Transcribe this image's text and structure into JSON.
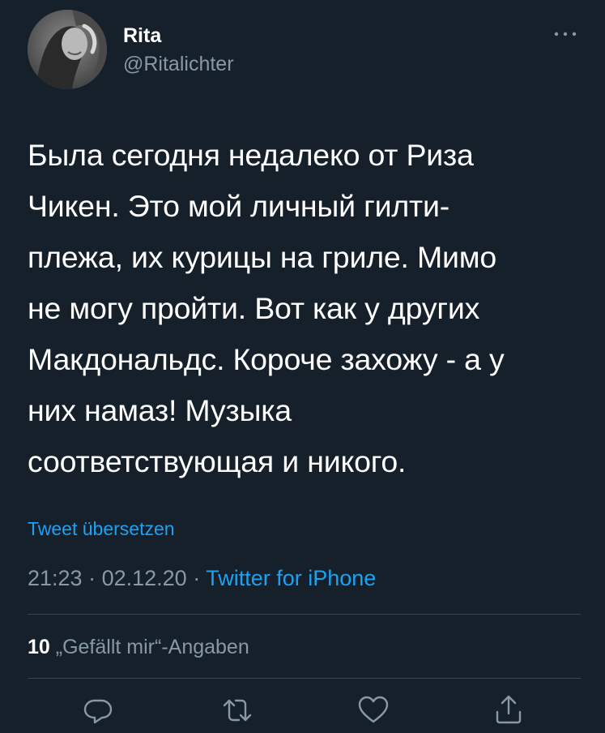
{
  "user": {
    "display_name": "Rita",
    "handle": "@Ritalichter",
    "avatar_icon": "avatar-photo"
  },
  "tweet": {
    "lines": [
      "Была сегодня недалеко от Риза",
      "Чикен. Это мой личный гилти-",
      "плежа, их курицы на гриле. Мимо",
      "не могу пройти. Вот как у других",
      "Макдональдс. Короче захожу - а у",
      "них намаз! Музыка",
      "соответствующая и никого."
    ],
    "translate_label": "Tweet übersetzen"
  },
  "meta": {
    "time": "21:23",
    "separator": " · ",
    "date": "02.12.20",
    "source": "Twitter for iPhone"
  },
  "likes": {
    "count": "10",
    "label": " „Gefällt mir“-Angaben"
  },
  "actions": [
    {
      "icon": "reply-icon"
    },
    {
      "icon": "retweet-icon"
    },
    {
      "icon": "like-icon"
    },
    {
      "icon": "share-icon"
    }
  ],
  "colors": {
    "background": "#15202b",
    "text": "#ffffff",
    "muted": "#8899a6",
    "accent": "#1da1f2",
    "divider": "#38444d"
  }
}
